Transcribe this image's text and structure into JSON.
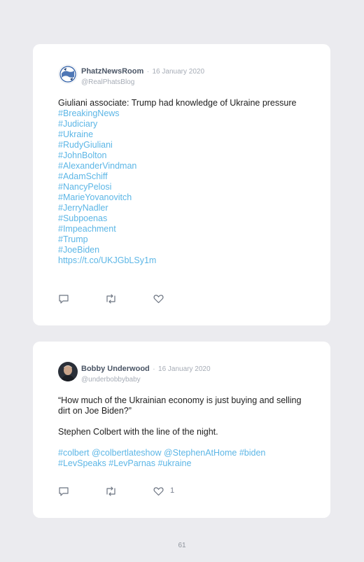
{
  "colors": {
    "background": "#ebebef",
    "card": "#ffffff",
    "hashtag": "#5cb6e6",
    "name": "#4a5565",
    "muted": "#a6acb6"
  },
  "tweets": [
    {
      "name": "PhatzNewsRoom",
      "separator": "·",
      "date": "16 January 2020",
      "handle": "@RealPhatsBlog",
      "text": "Giuliani associate: Trump had knowledge of Ukraine pressure",
      "hashtags": [
        "#BreakingNews",
        "#Judiciary",
        "#Ukraine",
        "#RudyGiuliani",
        "#JohnBolton",
        "#AlexanderVindman",
        "#AdamSchiff",
        "#NancyPelosi",
        "#MarieYovanovitch",
        "#JerryNadler",
        "#Subpoenas",
        "#Impeachment",
        "#Trump",
        "#JoeBiden"
      ],
      "link": "https://t.co/UKJGbLSy1m",
      "icons": [
        "reply-icon",
        "retweet-icon",
        "heart-icon"
      ]
    },
    {
      "name": "Bobby Underwood",
      "separator": "·",
      "date": "16 January 2020",
      "handle": "@underbobbybaby",
      "quote": "“How much of the Ukrainian economy is just buying and selling dirt on Joe Biden?”",
      "text2": "Stephen Colbert with the line of the night.",
      "tags_line1": "#colbert @colbertlateshow @StephenAtHome #biden",
      "tags_line2": "#LevSpeaks #LevParnas #ukraine",
      "likes": "1",
      "icons": [
        "reply-icon",
        "retweet-icon",
        "heart-icon"
      ]
    }
  ],
  "page_number": "61"
}
